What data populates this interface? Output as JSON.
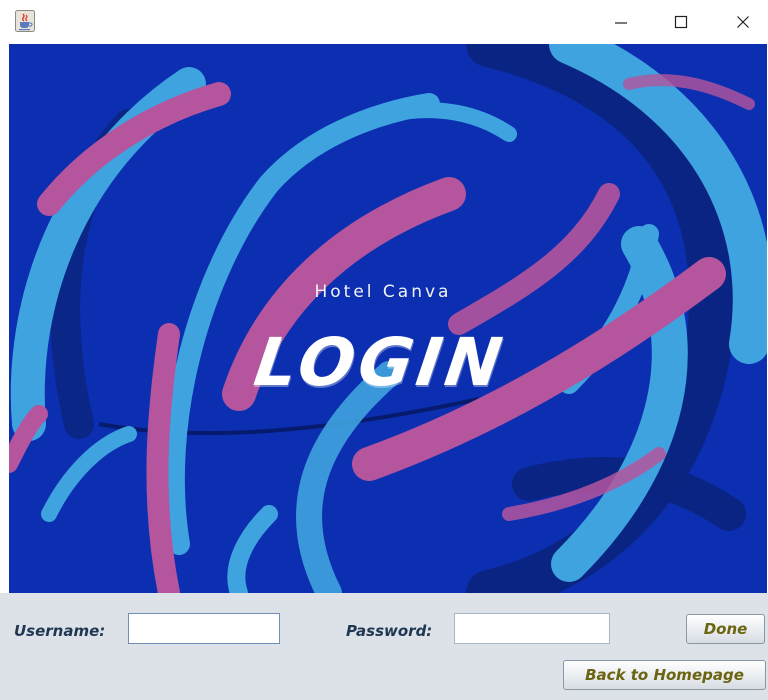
{
  "window": {
    "icon": "java-cup-icon",
    "controls": {
      "minimize": "minimize-icon",
      "maximize": "maximize-icon",
      "close": "close-icon"
    }
  },
  "banner": {
    "brand": "Hotel Canva",
    "headline": "LOGIN",
    "colors": {
      "background": "#0b2fb0",
      "pink": "#b4559d",
      "cyan": "#3fa3df",
      "navy": "#0a2480"
    }
  },
  "form": {
    "username_label": "Username:",
    "username_value": "",
    "password_label": "Password:",
    "password_value": "",
    "done_label": "Done",
    "back_label": "Back to Homepage"
  }
}
